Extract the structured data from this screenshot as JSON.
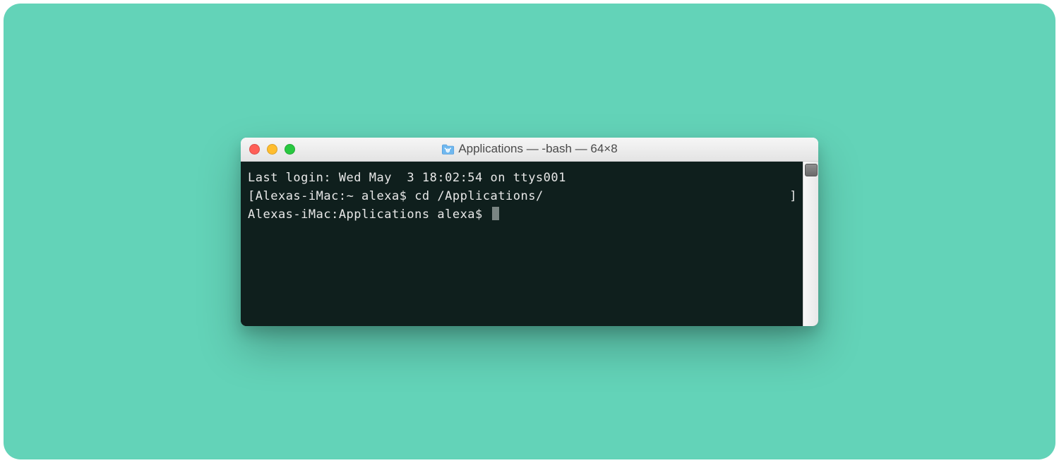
{
  "window": {
    "title": "Applications — -bash — 64×8",
    "traffic_lights": {
      "close": "close",
      "minimize": "minimize",
      "maximize": "maximize"
    }
  },
  "terminal": {
    "line1": "Last login: Wed May  3 18:02:54 on ttys001",
    "line2_open": "[",
    "line2_prompt": "Alexas-iMac:~ alexa$ ",
    "line2_command": "cd /Applications/",
    "line2_close": "]",
    "line3_prompt": "Alexas-iMac:Applications alexa$ "
  }
}
